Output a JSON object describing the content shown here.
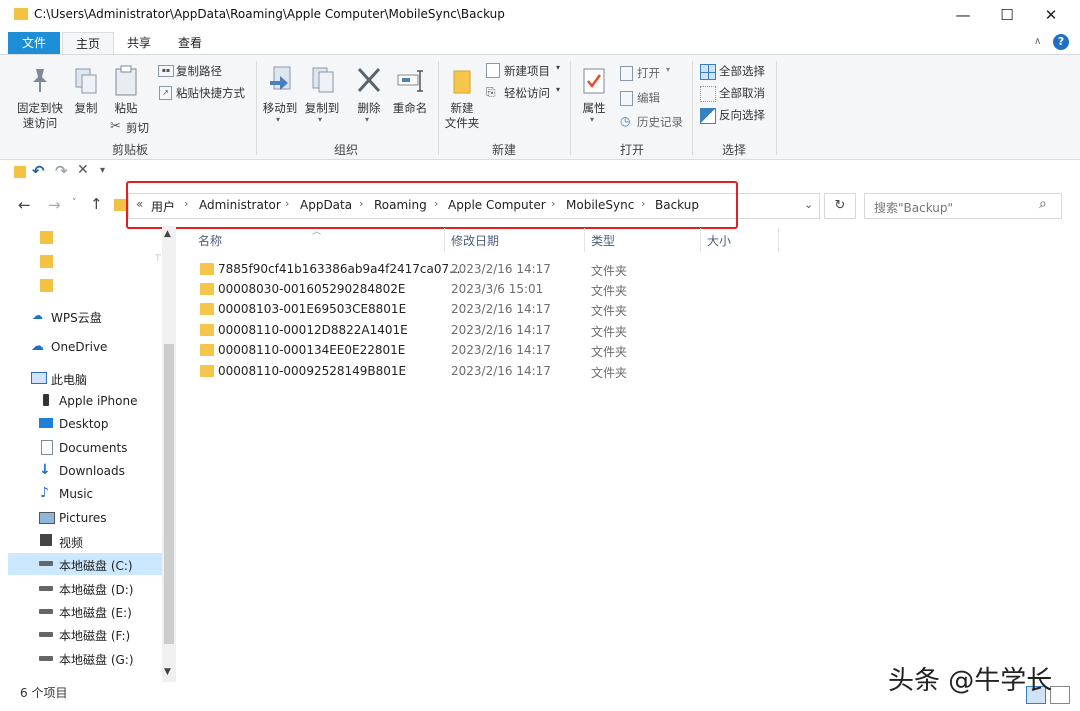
{
  "window": {
    "title": "C:\\Users\\Administrator\\AppData\\Roaming\\Apple Computer\\MobileSync\\Backup",
    "minimize": "—",
    "maximize": "☐",
    "close": "✕"
  },
  "tabs": {
    "file": "文件",
    "home": "主页",
    "share": "共享",
    "view": "查看"
  },
  "ribbon": {
    "pin_line1": "固定到快",
    "pin_line2": "速访问",
    "copy": "复制",
    "paste": "粘贴",
    "copy_path": "复制路径",
    "paste_shortcut": "粘贴快捷方式",
    "cut": "剪切",
    "group_clipboard": "剪贴板",
    "move_to": "移动到",
    "copy_to": "复制到",
    "delete": "删除",
    "rename": "重命名",
    "group_organize": "组织",
    "new_item": "新建项目",
    "easy_access": "轻松访问",
    "new_folder_line1": "新建",
    "new_folder_line2": "文件夹",
    "group_new": "新建",
    "properties": "属性",
    "open": "打开",
    "edit": "编辑",
    "history": "历史记录",
    "group_open": "打开",
    "select_all": "全部选择",
    "select_none": "全部取消",
    "invert_selection": "反向选择",
    "group_select": "选择",
    "help": "?"
  },
  "address": {
    "overflow": "«",
    "crumbs": [
      "用户",
      "Administrator",
      "AppData",
      "Roaming",
      "Apple Computer",
      "MobileSync",
      "Backup"
    ],
    "search_placeholder": "搜索\"Backup\""
  },
  "nav": {
    "wps": "WPS云盘",
    "onedrive": "OneDrive",
    "thispc": "此电脑",
    "iphone": "Apple iPhone",
    "desktop": "Desktop",
    "documents": "Documents",
    "downloads": "Downloads",
    "music": "Music",
    "pictures": "Pictures",
    "videos": "视频",
    "disk_c": "本地磁盘 (C:)",
    "disk_d": "本地磁盘 (D:)",
    "disk_e": "本地磁盘 (E:)",
    "disk_f": "本地磁盘 (F:)",
    "disk_g": "本地磁盘 (G:)"
  },
  "columns": {
    "name": "名称",
    "date": "修改日期",
    "type": "类型",
    "size": "大小"
  },
  "files": [
    {
      "name": "7885f90cf41b163386ab9a4f2417ca07...",
      "date": "2023/2/16 14:17",
      "type": "文件夹"
    },
    {
      "name": "00008030-001605290284802E",
      "date": "2023/3/6 15:01",
      "type": "文件夹"
    },
    {
      "name": "00008103-001E69503CE8801E",
      "date": "2023/2/16 14:17",
      "type": "文件夹"
    },
    {
      "name": "00008110-00012D8822A1401E",
      "date": "2023/2/16 14:17",
      "type": "文件夹"
    },
    {
      "name": "00008110-000134EE0E22801E",
      "date": "2023/2/16 14:17",
      "type": "文件夹"
    },
    {
      "name": "00008110-00092528149B801E",
      "date": "2023/2/16 14:17",
      "type": "文件夹"
    }
  ],
  "status": {
    "count": "6 个项目"
  },
  "watermark": "头条 @牛学长"
}
